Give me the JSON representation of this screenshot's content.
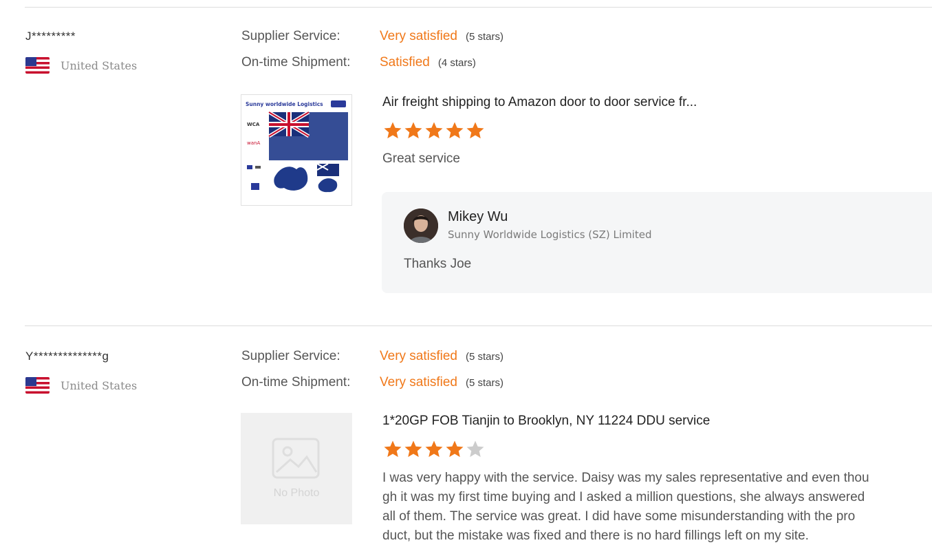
{
  "reviews": [
    {
      "buyer": "J*********",
      "country": "United States",
      "flag_icon": "us-flag-icon",
      "supplier_service_label": "Supplier Service:",
      "supplier_service_value": "Very satisfied",
      "supplier_service_stars": "(5 stars)",
      "shipment_label": "On-time Shipment:",
      "shipment_value": "Satisfied",
      "shipment_stars": "(4 stars)",
      "product_title": "Air freight shipping to Amazon door to door service fr...",
      "product_image_text": "Sunny worldwide Logistics",
      "product_image_tags": [
        "WCA",
        "wanA"
      ],
      "rating": 5,
      "comment": "Great service",
      "reply": {
        "name": "Mikey Wu",
        "company": "Sunny Worldwide Logistics (SZ) Limited",
        "text": "Thanks Joe"
      }
    },
    {
      "buyer": "Y**************g",
      "country": "United States",
      "flag_icon": "us-flag-icon",
      "supplier_service_label": "Supplier Service:",
      "supplier_service_value": "Very satisfied",
      "supplier_service_stars": "(5 stars)",
      "shipment_label": "On-time Shipment:",
      "shipment_value": "Very satisfied",
      "shipment_stars": "(5 stars)",
      "product_title": "1*20GP FOB Tianjin to Brooklyn, NY 11224 DDU service",
      "product_image_text": "No Photo",
      "rating": 4,
      "comment_lines": [
        "I was very happy with the service. Daisy was my sales representative and even thou",
        "gh it was my first time buying and I asked a million questions, she always answered",
        "all of them. The service was great. I did have some misunderstanding with the pro",
        "duct, but the mistake was fixed and there is no hard fillings left on my site."
      ]
    }
  ],
  "colors": {
    "accent": "#f07819",
    "star_filled": "#f07819",
    "star_empty": "#cccccc",
    "reply_bg": "#f5f6f7"
  }
}
